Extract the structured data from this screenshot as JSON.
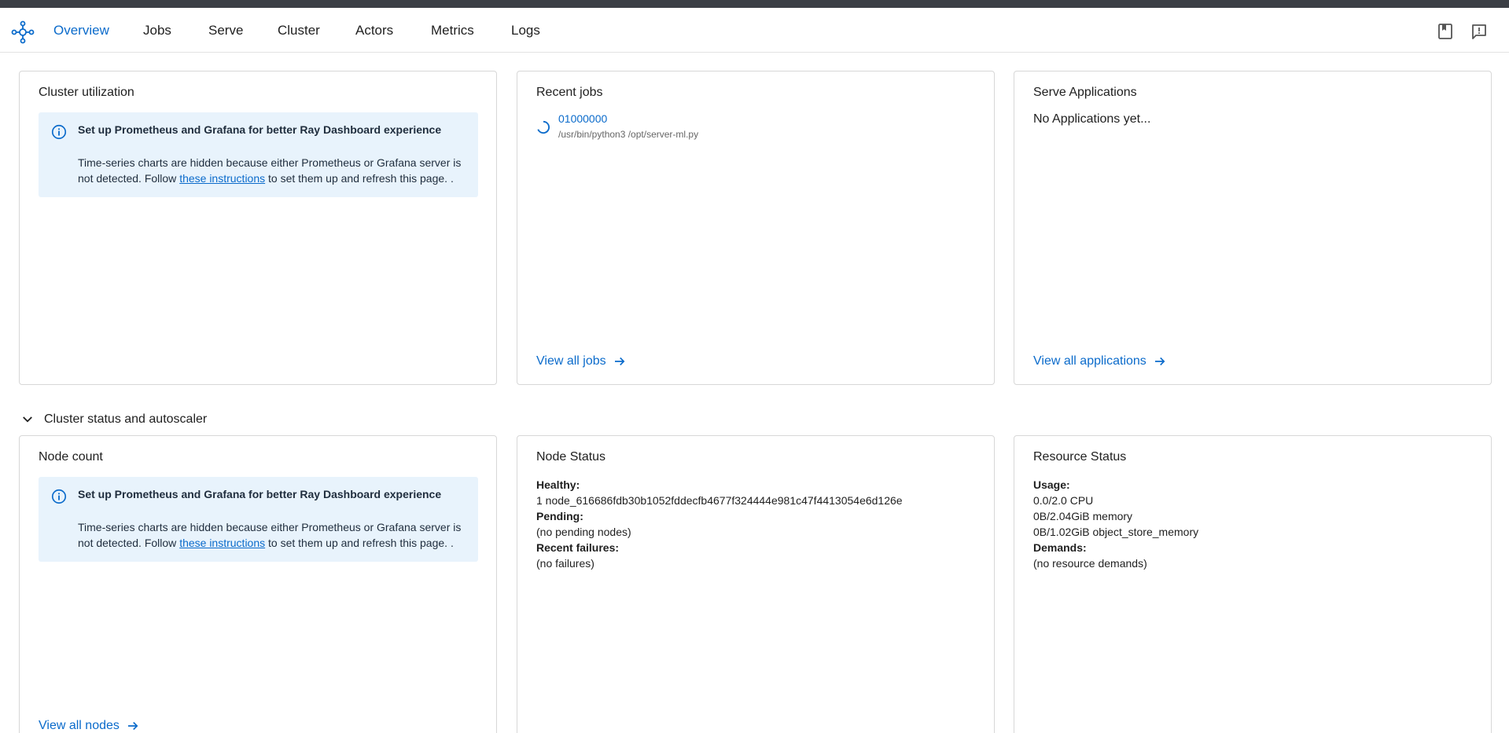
{
  "nav": {
    "items": [
      {
        "label": "Overview",
        "active": true
      },
      {
        "label": "Jobs"
      },
      {
        "label": "Serve"
      },
      {
        "label": "Cluster"
      },
      {
        "label": "Actors"
      },
      {
        "label": "Metrics"
      },
      {
        "label": "Logs"
      }
    ],
    "right_icons": [
      "docs-book-icon",
      "feedback-icon"
    ]
  },
  "cluster_utilization": {
    "title": "Cluster utilization",
    "alert": {
      "title": "Set up Prometheus and Grafana for better Ray Dashboard experience",
      "body_before": "Time-series charts are hidden because either Prometheus or Grafana server is not detected. Follow ",
      "link": "these instructions",
      "body_after": " to set them up and refresh this page. ."
    }
  },
  "recent_jobs": {
    "title": "Recent jobs",
    "jobs": [
      {
        "id": "01000000",
        "command": "/usr/bin/python3 /opt/server-ml.py"
      }
    ],
    "view_all": "View all jobs"
  },
  "serve_apps": {
    "title": "Serve Applications",
    "empty": "No Applications yet...",
    "view_all": "View all applications"
  },
  "section": {
    "label": "Cluster status and autoscaler"
  },
  "node_count": {
    "title": "Node count",
    "alert": {
      "title": "Set up Prometheus and Grafana for better Ray Dashboard experience",
      "body_before": "Time-series charts are hidden because either Prometheus or Grafana server is not detected. Follow ",
      "link": "these instructions",
      "body_after": " to set them up and refresh this page. ."
    },
    "view_all": "View all nodes"
  },
  "node_status": {
    "title": "Node Status",
    "healthy_label": "Healthy:",
    "healthy_value": "1 node_616686fdb30b1052fddecfb4677f324444e981c47f4413054e6d126e",
    "pending_label": "Pending:",
    "pending_value": "(no pending nodes)",
    "failures_label": "Recent failures:",
    "failures_value": "(no failures)"
  },
  "resource_status": {
    "title": "Resource Status",
    "usage_label": "Usage:",
    "cpu": "0.0/2.0 CPU",
    "memory": "0B/2.04GiB memory",
    "object_store": "0B/1.02GiB object_store_memory",
    "demands_label": "Demands:",
    "demands_value": "(no resource demands)"
  },
  "colors": {
    "accent": "#0b6bcb",
    "alert_bg": "#e8f3fc",
    "border": "#d7d7d7"
  }
}
